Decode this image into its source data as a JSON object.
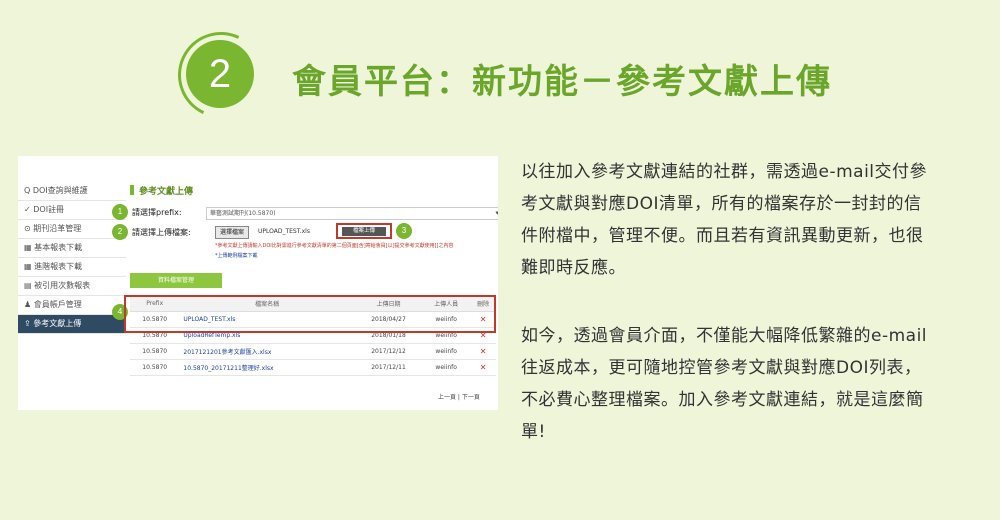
{
  "header": {
    "step_number": "2",
    "title": "會員平台：新功能－參考文獻上傳"
  },
  "screenshot": {
    "sidebar": [
      {
        "label": "Q DOI查詢與維護"
      },
      {
        "label": "✓ DOI註冊"
      },
      {
        "label": "⊙ 期刊沿革管理"
      },
      {
        "label": "▦ 基本報表下載"
      },
      {
        "label": "▦ 進階報表下載"
      },
      {
        "label": "▤ 被引用次數報表"
      },
      {
        "label": "♟ 會員帳戶管理"
      },
      {
        "label": "⇪ 參考文獻上傳"
      }
    ],
    "panel_title": "參考文獻上傳",
    "prefix_label": "請選擇prefix:",
    "prefix_value": "華藝測試期刊(10.5870)",
    "file_label": "請選擇上傳檔案:",
    "choose_button": "選擇檔案",
    "chosen_file": "UPLOAD_TEST.xls",
    "upload_button": "檔案上傳",
    "note1": "*參考文獻上傳請輸入DOI比對需進行參考文獻清單的第二個頁面[含]寄給會員[以]提交參考文獻使用[]之內容",
    "note2": "*上傳範例檔案下載",
    "manage_button": "資料檔案管理",
    "badges": [
      "1",
      "2",
      "3",
      "4"
    ],
    "table": {
      "headers": [
        "Prefix",
        "檔案名稱",
        "上傳日期",
        "上傳人員",
        "刪除"
      ],
      "rows": [
        [
          "10.5870",
          "UPLOAD_TEST.xls",
          "2018/04/27",
          "weiinfo",
          "✕"
        ],
        [
          "10.5870",
          "UploadRefTemp.xls",
          "2018/01/18",
          "weiinfo",
          "✕"
        ],
        [
          "10.5870",
          "2017121201參考文獻匯入.xlsx",
          "2017/12/12",
          "weiinfo",
          "✕"
        ],
        [
          "10.5870",
          "10.5870_20171211整理好.xlsx",
          "2017/12/11",
          "weiinfo",
          "✕"
        ]
      ]
    },
    "pager": "上一頁 | 下一頁"
  },
  "paragraphs": [
    {
      "lines": [
        "以往加入參考文獻連結的社群，需透過e-mail交付參",
        "考文獻與對應DOI清單，所有的檔案存於一封封的信",
        "件附檔中，管理不便。而且若有資訊異動更新，也很",
        "難即時反應。"
      ]
    },
    {
      "lines": [
        "如今，透過會員介面，不僅能大幅降低繁雜的e-mail",
        "往返成本，更可隨地控管參考文獻與對應DOI列表，",
        "不必費心整理檔案。加入參考文獻連結，就是這麼簡",
        "單!"
      ]
    }
  ],
  "colors": {
    "accent": "#7ab630",
    "highlight": "#c0392b",
    "background": "#eef5d9"
  }
}
